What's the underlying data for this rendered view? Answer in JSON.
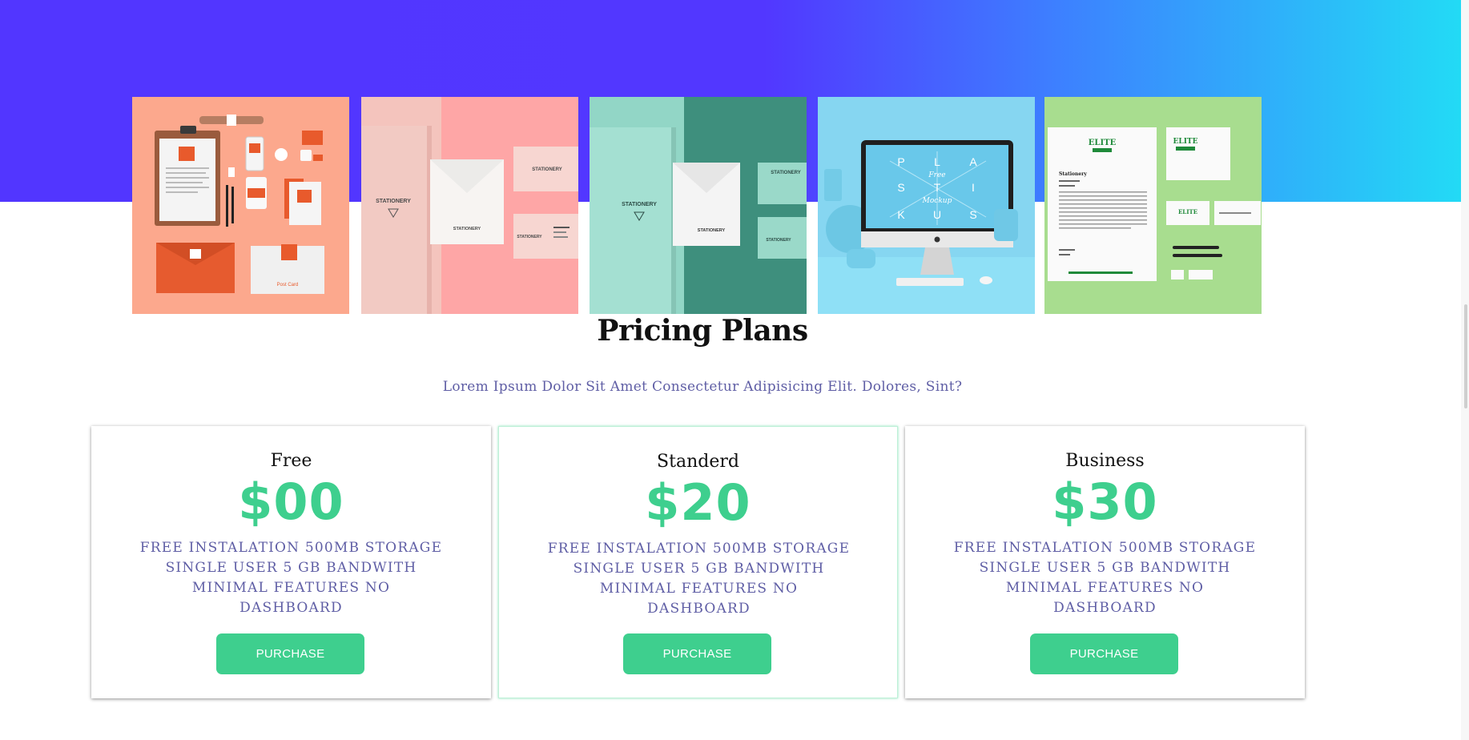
{
  "hero": {
    "gradient_colors": [
      "#5236ff",
      "#3d80ff",
      "#22dcf5"
    ]
  },
  "gallery": {
    "items": [
      {
        "name": "branding-stationery-orange",
        "bg": "#fba58a",
        "texts": {
          "small": "Post Card"
        }
      },
      {
        "name": "stationery-pink",
        "bg": "#f7b6b4",
        "texts": {
          "brand": "STATIONERY"
        }
      },
      {
        "name": "stationery-teal",
        "bg": "#8fd8c8",
        "texts": {
          "brand": "STATIONERY"
        }
      },
      {
        "name": "free-mockup-imac",
        "bg": "#7fd3ef",
        "texts": {
          "letters": [
            "P",
            "L",
            "A",
            "S",
            "T",
            "I",
            "K",
            "U",
            "S"
          ],
          "free": "Free",
          "mockup": "Mockup"
        }
      },
      {
        "name": "elite-stationery-green",
        "bg": "#a7dd8e",
        "texts": {
          "logo": "ELITE",
          "doc_title": "Stationery"
        }
      }
    ]
  },
  "pricing": {
    "title": "Pricing Plans",
    "subtitle": "Lorem Ipsum Dolor Sit Amet Consectetur Adipisicing Elit. Dolores, Sint?",
    "plans": [
      {
        "name": "Free",
        "price": "$00",
        "features": "free instalation 500mb storage single user 5 gb bandwith minimal features no dashboard",
        "button_label": "PURCHASE"
      },
      {
        "name": "Standerd",
        "price": "$20",
        "features": "free instalation 500mb storage single user 5 gb bandwith minimal features no dashboard",
        "button_label": "PURCHASE"
      },
      {
        "name": "Business",
        "price": "$30",
        "features": "free instalation 500mb storage single user 5 gb bandwith minimal features no dashboard",
        "button_label": "PURCHASE"
      }
    ]
  },
  "colors": {
    "accent": "#3ecf8e",
    "text_muted": "#5f5ea5"
  }
}
